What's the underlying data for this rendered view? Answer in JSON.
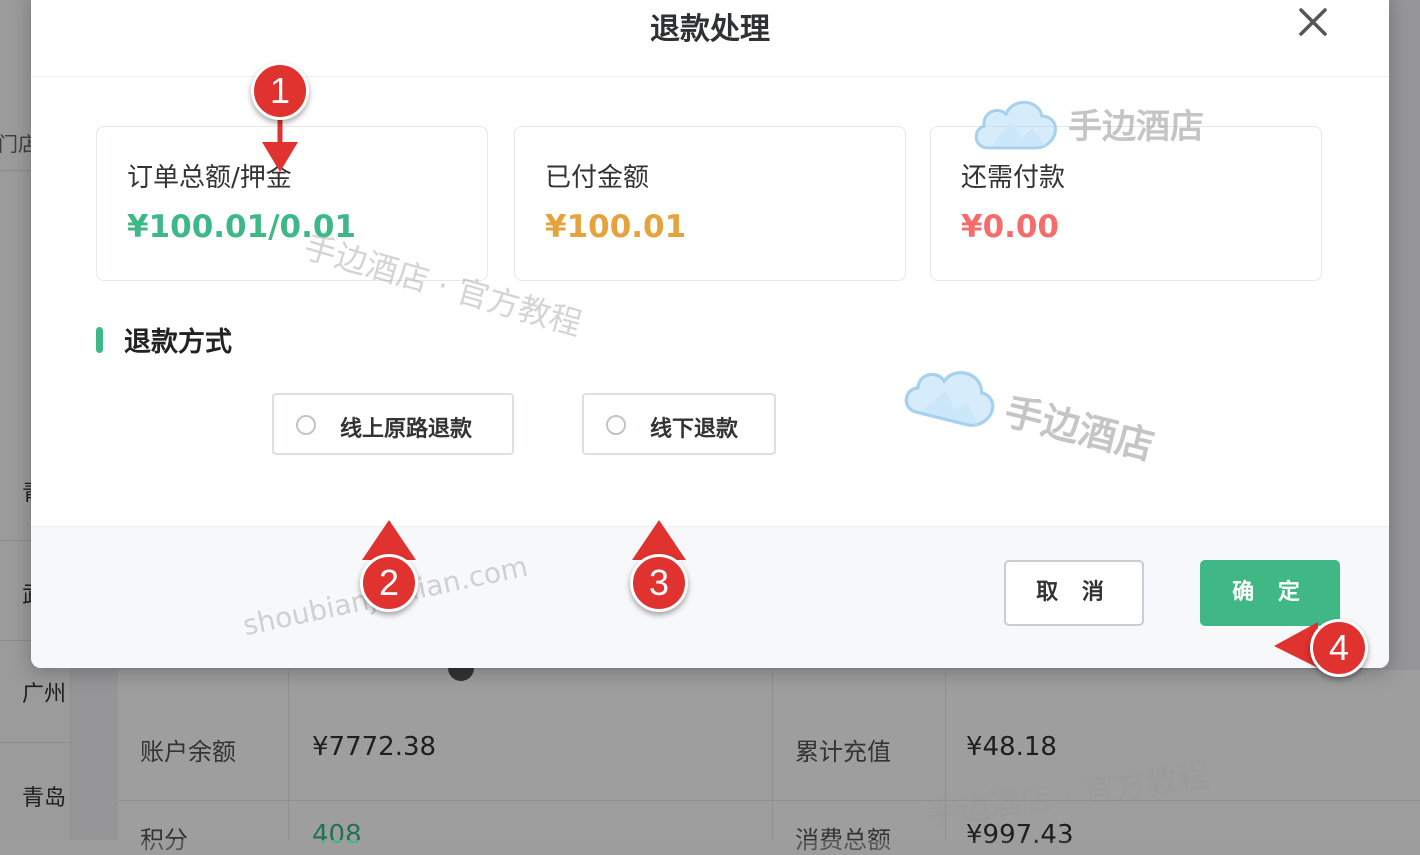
{
  "background": {
    "sidebar_items": [
      "门店",
      "青",
      "武",
      "广州",
      "青岛"
    ],
    "rows": [
      {
        "label": "账户余额",
        "value": "¥7772.38",
        "label2": "累计充值",
        "value2": "¥48.18"
      },
      {
        "label": "积分",
        "value": "408",
        "label2": "消费总额",
        "value2": "¥997.43"
      }
    ]
  },
  "dialog": {
    "title": "退款处理",
    "cards": [
      {
        "label": "订单总额/押金",
        "value": "¥100.01/0.01",
        "color": "#3db887"
      },
      {
        "label": "已付金额",
        "value": "¥100.01",
        "color": "#e6a23c"
      },
      {
        "label": "还需付款",
        "value": "¥0.00",
        "color": "#f56c6c"
      }
    ],
    "section_title": "退款方式",
    "refund_options": [
      "线上原路退款",
      "线下退款"
    ],
    "buttons": {
      "cancel": "取 消",
      "confirm": "确 定"
    }
  },
  "watermarks": {
    "brand": "手边酒店",
    "tagline": "手边酒店 · 官方教程",
    "url": "shoubianjiudian.com"
  },
  "annotations": [
    "1",
    "2",
    "3",
    "4"
  ],
  "colors": {
    "accent": "#3db887",
    "marker": "#e0322f"
  }
}
